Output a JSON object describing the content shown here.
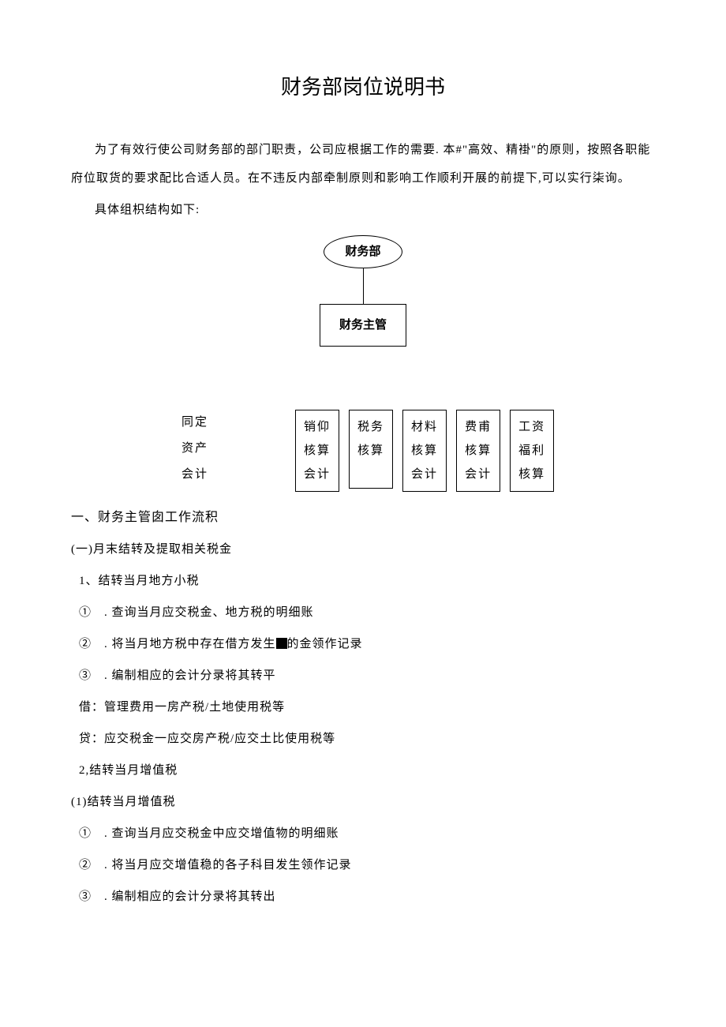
{
  "title": "财务部岗位说明书",
  "intro": "为了有效行使公司财务部的部门职责，公司应根据工作的需要. 本#\"高效、精褂\"的原则，按照各职能府位取货的要求配比合适人员。在不违反内部牵制原则和影响工作顺利开展的前提下,可以实行柒询。",
  "struct_label": "具体组枳结构如下:",
  "diagram": {
    "root": "财务部",
    "child": "财务主管"
  },
  "boxes": {
    "col0": {
      "l1": "同定",
      "l2": "资产",
      "l3": "会计"
    },
    "col1": {
      "l1": "销仰",
      "l2": "核算",
      "l3": "会计"
    },
    "col2": {
      "l1": "税务",
      "l2": "核算"
    },
    "col3": {
      "l1": "材料",
      "l2": "核算",
      "l3": "会计"
    },
    "col4": {
      "l1": "费甫",
      "l2": "核算",
      "l3": "会计"
    },
    "col5": {
      "l1": "工资",
      "l2": "福利",
      "l3": "核算"
    }
  },
  "sections": {
    "h1": "一、财务主管囱工作流积",
    "s1": {
      "title": "(一)月末结转及提取相关税金",
      "item1": {
        "title": "1、结转当月地方小税",
        "a": "①　. 查询当月应交税金、地方税的明细账",
        "b_pre": "②　. 将当月地方税中存在借方发生",
        "b_post": "的金领作记录",
        "c": "③　. 编制相应的会计分录将其转平",
        "debit": "借：管理费用一房产税/土地使用税等",
        "credit": "贷：应交税金一应交房产税/应交土比使用税等"
      },
      "item2": {
        "title": "2,结转当月增值税",
        "sub": "(1)结转当月增值税",
        "a": "①　. 查询当月应交税金中应交增值物的明细账",
        "b": "②　. 将当月应交增值稳的各子科目发生领作记录",
        "c": "③　. 编制相应的会计分录将其转出"
      }
    }
  }
}
